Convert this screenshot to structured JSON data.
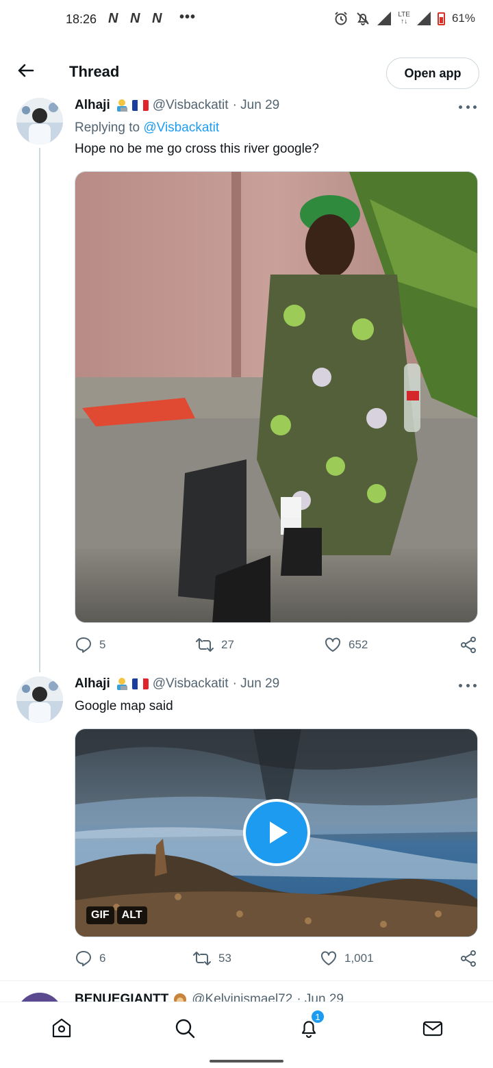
{
  "status": {
    "time": "18:26",
    "n_icons": [
      "N",
      "N",
      "N"
    ],
    "more": "•••",
    "lte": "LTE",
    "battery": "61%"
  },
  "header": {
    "title": "Thread",
    "open_app": "Open app"
  },
  "tweets": [
    {
      "name": "Alhaji",
      "handle": "@Visbackatit",
      "date": "· Jun 29",
      "replying_label": "Replying to",
      "replying_handle": "@Visbackatit",
      "text": "Hope no be me go cross this river google?",
      "replies": "5",
      "retweets": "27",
      "likes": "652"
    },
    {
      "name": "Alhaji",
      "handle": "@Visbackatit",
      "date": "· Jun 29",
      "text": "Google map said",
      "gif_badge": "GIF",
      "alt_badge": "ALT",
      "replies": "6",
      "retweets": "53",
      "likes": "1,001"
    },
    {
      "name": "BENUEGIANTT",
      "handle": "@Kelvinismael72",
      "date": "· Jun 29"
    }
  ],
  "nav": {
    "notifications_count": "1"
  },
  "colors": {
    "accent": "#1d9bf0",
    "text": "#0f1419",
    "muted": "#536471"
  }
}
